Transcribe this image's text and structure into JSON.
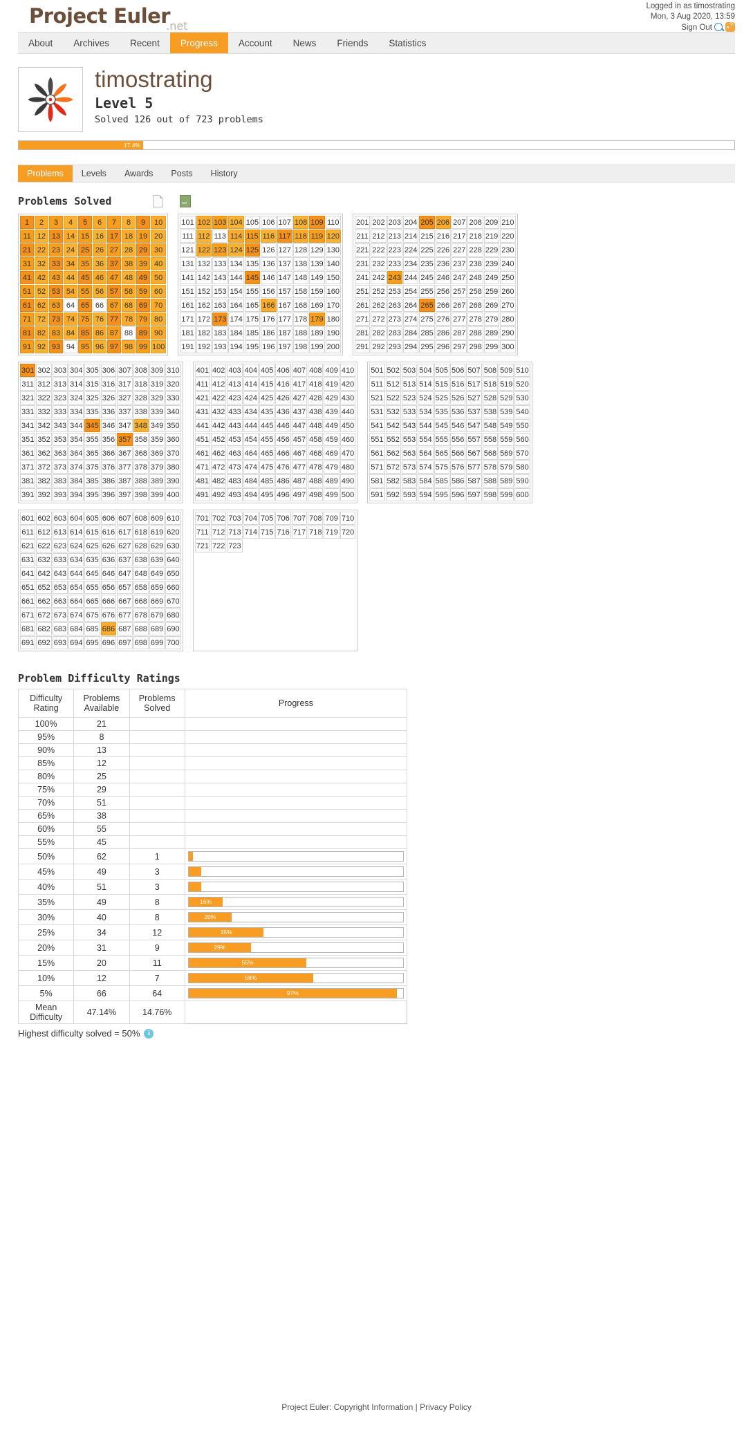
{
  "header": {
    "logo_main": "Project Euler",
    "logo_suffix": ".net",
    "logged_in_as": "Logged in as timostrating",
    "datetime": "Mon, 3 Aug 2020, 13:59",
    "sign_out": "Sign Out",
    "search_icon": "search-icon",
    "rss_icon": "rss-icon"
  },
  "nav": {
    "items": [
      {
        "label": "About",
        "active": false
      },
      {
        "label": "Archives",
        "active": false
      },
      {
        "label": "Recent",
        "active": false
      },
      {
        "label": "Progress",
        "active": true
      },
      {
        "label": "Account",
        "active": false
      },
      {
        "label": "News",
        "active": false
      },
      {
        "label": "Friends",
        "active": false
      },
      {
        "label": "Statistics",
        "active": false
      }
    ]
  },
  "profile": {
    "username": "timostrating",
    "level": "Level 5",
    "solved_line": "Solved 126 out of 723 problems",
    "progress_percent_label": "17.4%",
    "progress_percent": 17.4
  },
  "subtabs": {
    "items": [
      {
        "label": "Problems",
        "active": true
      },
      {
        "label": "Levels",
        "active": false
      },
      {
        "label": "Awards",
        "active": false
      },
      {
        "label": "Posts",
        "active": false
      },
      {
        "label": "History",
        "active": false
      }
    ]
  },
  "problems_section": {
    "title": "Problems Solved",
    "txt_icon": "text-file-icon",
    "csv_icon": "csv-file-icon",
    "csv_label": "csv",
    "blocks": [
      {
        "start": 1,
        "end": 100
      },
      {
        "start": 101,
        "end": 200
      },
      {
        "start": 201,
        "end": 300
      },
      {
        "start": 301,
        "end": 400
      },
      {
        "start": 401,
        "end": 500
      },
      {
        "start": 501,
        "end": 600
      },
      {
        "start": 601,
        "end": 700
      },
      {
        "start": 701,
        "end": 723
      }
    ],
    "solved": [
      1,
      2,
      3,
      4,
      5,
      6,
      7,
      8,
      9,
      10,
      11,
      12,
      13,
      14,
      15,
      16,
      17,
      18,
      19,
      20,
      21,
      22,
      23,
      24,
      25,
      26,
      27,
      28,
      29,
      30,
      31,
      32,
      33,
      34,
      35,
      36,
      37,
      38,
      39,
      40,
      41,
      42,
      43,
      44,
      45,
      46,
      47,
      48,
      49,
      50,
      51,
      52,
      53,
      54,
      55,
      56,
      57,
      58,
      59,
      60,
      61,
      62,
      63,
      65,
      67,
      68,
      69,
      70,
      71,
      72,
      73,
      74,
      75,
      76,
      77,
      78,
      79,
      80,
      81,
      82,
      83,
      84,
      85,
      86,
      87,
      89,
      90,
      91,
      92,
      93,
      95,
      96,
      97,
      98,
      99,
      100,
      102,
      103,
      104,
      108,
      109,
      112,
      114,
      115,
      116,
      117,
      118,
      119,
      120,
      122,
      123,
      124,
      125,
      145,
      166,
      173,
      179,
      205,
      206,
      243,
      265,
      301,
      345,
      348,
      357,
      686
    ]
  },
  "difficulty": {
    "title": "Problem Difficulty Ratings",
    "columns": [
      "Difficulty Rating",
      "Problems Available",
      "Problems Solved",
      "Progress"
    ],
    "rows": [
      {
        "rating": "100%",
        "available": "21",
        "solved": "",
        "percent": null,
        "percent_label": ""
      },
      {
        "rating": "95%",
        "available": "8",
        "solved": "",
        "percent": null,
        "percent_label": ""
      },
      {
        "rating": "90%",
        "available": "13",
        "solved": "",
        "percent": null,
        "percent_label": ""
      },
      {
        "rating": "85%",
        "available": "12",
        "solved": "",
        "percent": null,
        "percent_label": ""
      },
      {
        "rating": "80%",
        "available": "25",
        "solved": "",
        "percent": null,
        "percent_label": ""
      },
      {
        "rating": "75%",
        "available": "29",
        "solved": "",
        "percent": null,
        "percent_label": ""
      },
      {
        "rating": "70%",
        "available": "51",
        "solved": "",
        "percent": null,
        "percent_label": ""
      },
      {
        "rating": "65%",
        "available": "38",
        "solved": "",
        "percent": null,
        "percent_label": ""
      },
      {
        "rating": "60%",
        "available": "55",
        "solved": "",
        "percent": null,
        "percent_label": ""
      },
      {
        "rating": "55%",
        "available": "45",
        "solved": "",
        "percent": null,
        "percent_label": ""
      },
      {
        "rating": "50%",
        "available": "62",
        "solved": "1",
        "percent": 2,
        "percent_label": ""
      },
      {
        "rating": "45%",
        "available": "49",
        "solved": "3",
        "percent": 6,
        "percent_label": ""
      },
      {
        "rating": "40%",
        "available": "51",
        "solved": "3",
        "percent": 6,
        "percent_label": ""
      },
      {
        "rating": "35%",
        "available": "49",
        "solved": "8",
        "percent": 16,
        "percent_label": "16%"
      },
      {
        "rating": "30%",
        "available": "40",
        "solved": "8",
        "percent": 20,
        "percent_label": "20%"
      },
      {
        "rating": "25%",
        "available": "34",
        "solved": "12",
        "percent": 35,
        "percent_label": "35%"
      },
      {
        "rating": "20%",
        "available": "31",
        "solved": "9",
        "percent": 29,
        "percent_label": "29%"
      },
      {
        "rating": "15%",
        "available": "20",
        "solved": "11",
        "percent": 55,
        "percent_label": "55%"
      },
      {
        "rating": "10%",
        "available": "12",
        "solved": "7",
        "percent": 58,
        "percent_label": "58%"
      },
      {
        "rating": "5%",
        "available": "66",
        "solved": "64",
        "percent": 97,
        "percent_label": "97%"
      }
    ],
    "mean_label": "Mean Difficulty",
    "mean_available": "47.14%",
    "mean_solved": "14.76%",
    "highest_line": "Highest difficulty solved = 50%",
    "info_icon": "info-icon",
    "info_glyph": "i"
  },
  "chart_data": {
    "type": "bar",
    "title": "Problem Difficulty Ratings",
    "categories": [
      "100%",
      "95%",
      "90%",
      "85%",
      "80%",
      "75%",
      "70%",
      "65%",
      "60%",
      "55%",
      "50%",
      "45%",
      "40%",
      "35%",
      "30%",
      "25%",
      "20%",
      "15%",
      "10%",
      "5%"
    ],
    "series": [
      {
        "name": "Problems Available",
        "values": [
          21,
          8,
          13,
          12,
          25,
          29,
          51,
          38,
          55,
          45,
          62,
          49,
          51,
          49,
          40,
          34,
          31,
          20,
          12,
          66
        ]
      },
      {
        "name": "Problems Solved",
        "values": [
          0,
          0,
          0,
          0,
          0,
          0,
          0,
          0,
          0,
          0,
          1,
          3,
          3,
          8,
          8,
          12,
          9,
          11,
          7,
          64
        ]
      },
      {
        "name": "Progress %",
        "values": [
          null,
          null,
          null,
          null,
          null,
          null,
          null,
          null,
          null,
          null,
          2,
          6,
          6,
          16,
          20,
          35,
          29,
          55,
          58,
          97
        ]
      }
    ],
    "xlabel": "Difficulty Rating",
    "ylabel": "Problems",
    "grid": false,
    "legend": "none"
  },
  "footer": {
    "text_prefix": "Project Euler: ",
    "copyright": "Copyright Information",
    "sep": " | ",
    "privacy": "Privacy Policy"
  }
}
